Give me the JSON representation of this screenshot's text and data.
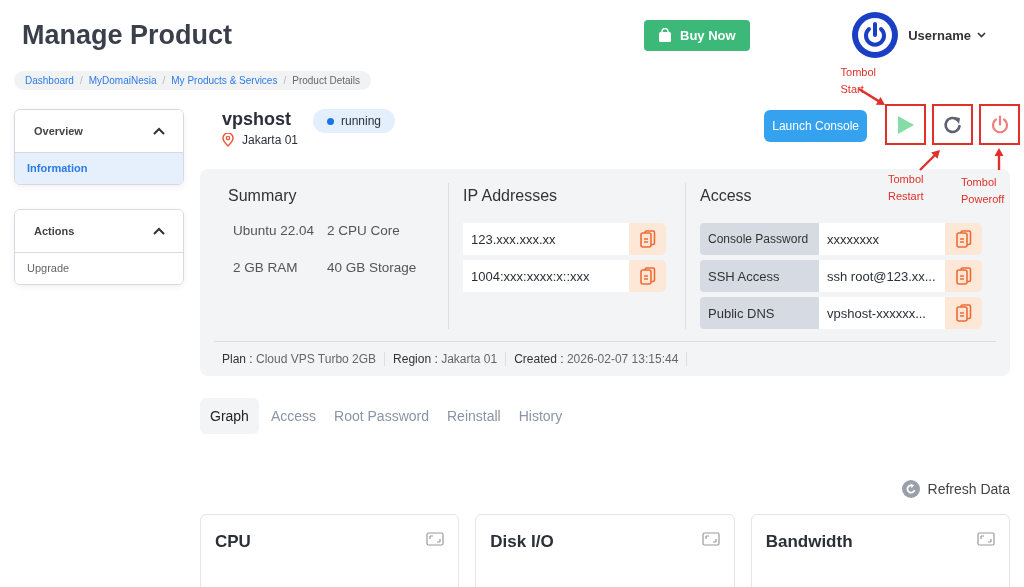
{
  "page_title": "Manage Product",
  "buy_button": "Buy Now",
  "user": {
    "name": "Username"
  },
  "breadcrumb_separator": "/",
  "breadcrumb": [
    {
      "label": "Dashboard",
      "link": true
    },
    {
      "label": "MyDomaiNesia",
      "link": true
    },
    {
      "label": "My Products & Services",
      "link": true
    },
    {
      "label": "Product Details",
      "link": false
    }
  ],
  "sidebar": [
    {
      "title": "Overview",
      "expanded": true,
      "items": [
        {
          "label": "Information",
          "selected": true
        }
      ]
    },
    {
      "title": "Actions",
      "expanded": true,
      "items": [
        {
          "label": "Upgrade",
          "selected": false
        }
      ]
    }
  ],
  "server": {
    "name": "vpshost",
    "status": "running",
    "location": "Jakarta 01"
  },
  "launch_button": "Launch Console",
  "power_buttons": [
    {
      "kind": "start",
      "annotation": {
        "label": "Tombol\nStart",
        "kind": "top-left"
      }
    },
    {
      "kind": "restart",
      "annotation": {
        "label": "Tombol\nRestart",
        "kind": "bottom-left"
      }
    },
    {
      "kind": "poweroff",
      "annotation": {
        "label": "Tombol\nPoweroff",
        "kind": "bottom"
      }
    }
  ],
  "summary": {
    "title": "Summary",
    "items": [
      "Ubuntu 22.04",
      "2 CPU Core",
      "2 GB RAM",
      "40 GB Storage"
    ]
  },
  "ip_addresses": {
    "title": "IP Addresses",
    "rows": [
      "123.xxx.xxx.xx",
      "1004:xxx:xxxx:x::xxx"
    ]
  },
  "access": {
    "title": "Access",
    "rows": [
      {
        "label": "Console Password",
        "value": "xxxxxxxx"
      },
      {
        "label": "SSH Access",
        "value": "ssh root@123.xx..."
      },
      {
        "label": "Public DNS",
        "value": "vpshost-xxxxxx..."
      }
    ]
  },
  "details": [
    {
      "label": "Plan :",
      "value": "Cloud VPS Turbo 2GB"
    },
    {
      "label": "Region :",
      "value": "Jakarta 01"
    },
    {
      "label": "Created :",
      "value": "2026-02-07 13:15:44"
    }
  ],
  "tabs": [
    {
      "label": "Graph",
      "selected": true
    },
    {
      "label": "Access",
      "selected": false
    },
    {
      "label": "Root Password",
      "selected": false
    },
    {
      "label": "Reinstall",
      "selected": false
    },
    {
      "label": "History",
      "selected": false
    }
  ],
  "refresh_button": "Refresh Data",
  "graph_cards": [
    "CPU",
    "Disk I/O",
    "Bandwidth"
  ]
}
